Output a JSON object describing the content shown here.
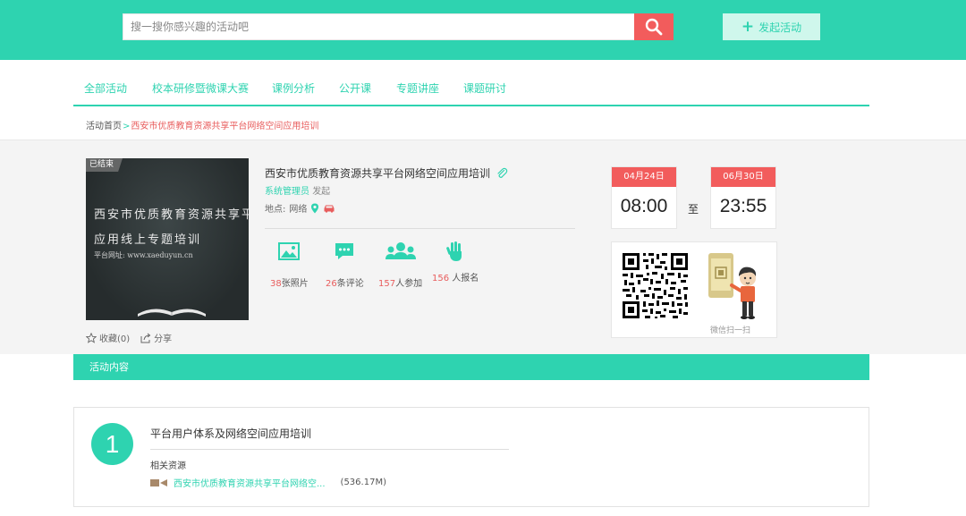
{
  "header": {
    "search_placeholder": "搜一搜你感兴趣的活动吧",
    "launch_label": "发起活动"
  },
  "nav": {
    "items": [
      "全部活动",
      "校本研修暨微课大赛",
      "课例分析",
      "公开课",
      "专题讲座",
      "课题研讨"
    ]
  },
  "breadcrumb": {
    "home": "活动首页",
    "separator": ">",
    "current": "西安市优质教育资源共享平台网络空间应用培训"
  },
  "activity": {
    "status_badge": "已结束",
    "poster_line1": "西安市优质教育资源共享平",
    "poster_line2": "应用线上专题培训",
    "poster_line3": "平台网址: www.xaeduyun.cn",
    "title": "西安市优质教育资源共享平台网络空间应用培训",
    "initiator": "系统管理员",
    "initiator_verb": "发起",
    "location_label": "地点:",
    "location_value": "网络",
    "favorite": "收藏(0)",
    "share": "分享"
  },
  "stats": [
    {
      "icon": "photo-icon",
      "num": "38",
      "label": "张照片"
    },
    {
      "icon": "comment-icon",
      "num": "26",
      "label": "条评论"
    },
    {
      "icon": "people-icon",
      "num": "157",
      "label": "人参加"
    },
    {
      "icon": "hand-icon",
      "num": "156",
      "label": " 人报名"
    }
  ],
  "schedule": {
    "start_date": "04月24日",
    "start_time": "08:00",
    "to": "至",
    "end_date": "06月30日",
    "end_time": "23:55"
  },
  "qr": {
    "label": "微信扫一扫"
  },
  "section": {
    "title": "活动内容"
  },
  "content_items": [
    {
      "index": "1",
      "title": "平台用户体系及网络空间应用培训",
      "resources_label": "相关资源",
      "resource_name": "西安市优质教育资源共享平台网络空...",
      "resource_size": "(536.17M)"
    }
  ],
  "colors": {
    "accent": "#2ed3b0",
    "danger": "#f25c5c",
    "highlight_text": "#e85d5d"
  }
}
